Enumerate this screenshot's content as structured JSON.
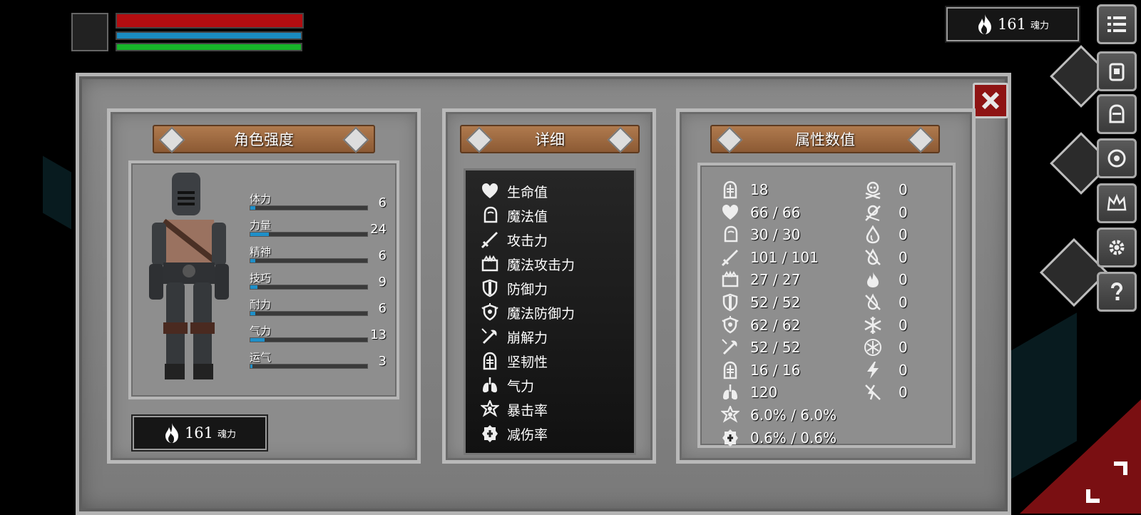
{
  "soul_counter": {
    "value": "161",
    "unit": "魂力"
  },
  "panels": {
    "character": {
      "title": "角色强度"
    },
    "details": {
      "title": "详细"
    },
    "attributes": {
      "title": "属性数值"
    }
  },
  "character_stats": [
    {
      "label": "体力",
      "value": "6",
      "fill": 0.04
    },
    {
      "label": "力量",
      "value": "24",
      "fill": 0.16
    },
    {
      "label": "精神",
      "value": "6",
      "fill": 0.04
    },
    {
      "label": "技巧",
      "value": "9",
      "fill": 0.06
    },
    {
      "label": "耐力",
      "value": "6",
      "fill": 0.04
    },
    {
      "label": "气力",
      "value": "13",
      "fill": 0.12
    },
    {
      "label": "运气",
      "value": "3",
      "fill": 0.02
    }
  ],
  "detail_items": [
    {
      "label": "生命值",
      "icon": "heart-icon"
    },
    {
      "label": "魔法值",
      "icon": "head-icon"
    },
    {
      "label": "攻击力",
      "icon": "sword-icon"
    },
    {
      "label": "魔法攻击力",
      "icon": "magic-book-icon"
    },
    {
      "label": "防御力",
      "icon": "shield-icon"
    },
    {
      "label": "魔法防御力",
      "icon": "magic-shield-icon"
    },
    {
      "label": "崩解力",
      "icon": "axe-icon"
    },
    {
      "label": "坚韧性",
      "icon": "helmet-icon"
    },
    {
      "label": "气力",
      "icon": "lungs-icon"
    },
    {
      "label": "暴击率",
      "icon": "star-icon"
    },
    {
      "label": "减伤率",
      "icon": "badge-icon"
    }
  ],
  "attribute_values": [
    {
      "icon": "helmet-icon",
      "value": "18"
    },
    {
      "icon": "heart-icon",
      "value": "66 / 66"
    },
    {
      "icon": "head-icon",
      "value": "30 / 30"
    },
    {
      "icon": "sword-icon",
      "value": "101 / 101"
    },
    {
      "icon": "magic-book-icon",
      "value": "27 / 27"
    },
    {
      "icon": "shield-icon",
      "value": "52 / 52"
    },
    {
      "icon": "magic-shield-icon",
      "value": "62 / 62"
    },
    {
      "icon": "axe-icon",
      "value": "52 / 52"
    },
    {
      "icon": "helmet-icon",
      "value": "16 / 16"
    },
    {
      "icon": "lungs-icon",
      "value": "120"
    },
    {
      "icon": "star-icon",
      "value": "6.0% / 6.0%"
    },
    {
      "icon": "badge-icon",
      "value": "0.6% / 0.6%"
    }
  ],
  "resistances": [
    {
      "icon": "skull-icon",
      "value": "0"
    },
    {
      "icon": "poison-icon",
      "value": "0"
    },
    {
      "icon": "drop-icon",
      "value": "0"
    },
    {
      "icon": "bleed-icon",
      "value": "0"
    },
    {
      "icon": "fire-icon",
      "value": "0"
    },
    {
      "icon": "burn-icon",
      "value": "0"
    },
    {
      "icon": "frost-icon",
      "value": "0"
    },
    {
      "icon": "freeze-icon",
      "value": "0"
    },
    {
      "icon": "lightning-icon",
      "value": "0"
    },
    {
      "icon": "shock-icon",
      "value": "0"
    }
  ],
  "colors": {
    "hp": "#b30d10",
    "mp": "#1a8bc0",
    "stamina": "#17b42a",
    "close": "#8e1414",
    "stat_bar": "#1e8fc8"
  }
}
